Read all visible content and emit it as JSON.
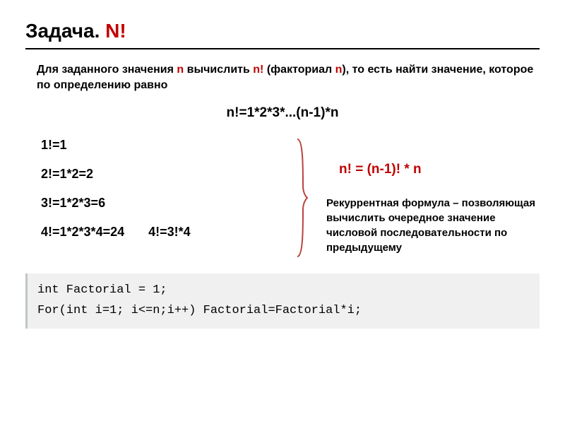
{
  "title": {
    "main": "Задача.",
    "accent": "N!"
  },
  "intro": {
    "part1": "Для заданного значения ",
    "n1": "n",
    "part2": " вычислить ",
    "n2": "n!",
    "part3": " (факториал ",
    "n3": "n",
    "part4": "), то есть найти значение, которое по определению равно"
  },
  "formula_main": "n!=1*2*3*...(n-1)*n",
  "examples": {
    "e1": "1!=1",
    "e2": "2!=1*2=2",
    "e3": "3!=1*2*3=6",
    "e4": "4!=1*2*3*4=24",
    "e4b": "4!=3!*4"
  },
  "recurrent": {
    "formula": "n! = (n-1)! * n",
    "text": "Рекуррентная формула – позволяющая вычислить очередное значение числовой последовательности по предыдущему"
  },
  "code": {
    "line1": "int Factorial = 1;",
    "line2": "For(int i=1; i<=n;i++) Factorial=Factorial*i;"
  }
}
